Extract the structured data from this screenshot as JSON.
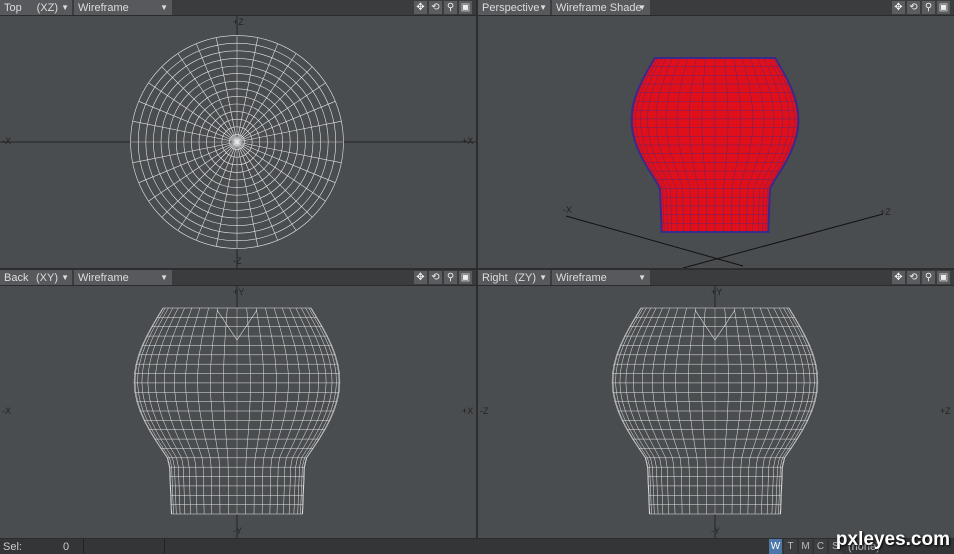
{
  "viewports": [
    {
      "view": "Top",
      "axes_code": "(XZ)",
      "mode": "Wireframe",
      "axis_labels": {
        "top": "+Z",
        "left": "-X",
        "right": "+X",
        "bottom": "-Z"
      }
    },
    {
      "view": "Perspective",
      "axes_code": "",
      "mode": "Wireframe Shade",
      "axis_labels": {
        "left": "-X",
        "right": "+Z"
      }
    },
    {
      "view": "Back",
      "axes_code": "(XY)",
      "mode": "Wireframe",
      "axis_labels": {
        "top": "+Y",
        "left": "-X",
        "right": "+X",
        "bottom": "-Y"
      }
    },
    {
      "view": "Right",
      "axes_code": "(ZY)",
      "mode": "Wireframe",
      "axis_labels": {
        "top": "+Y",
        "left": "-Z",
        "right": "+Z",
        "bottom": "-Y"
      }
    }
  ],
  "viewport_icons": [
    "move-icon",
    "rotate-icon",
    "zoom-icon",
    "maximize-icon"
  ],
  "status": {
    "sel_label": "Sel:",
    "sel_value": "0",
    "modes": [
      "W",
      "T",
      "M",
      "C",
      "S"
    ],
    "active_mode": "W",
    "surface": "(none)"
  },
  "watermark": "pxleyes.com",
  "colors": {
    "mesh_fill": "#e0101a",
    "mesh_edges": "#3a2a8a",
    "wire": "#e6e6e6",
    "background": "#4a4d50"
  }
}
